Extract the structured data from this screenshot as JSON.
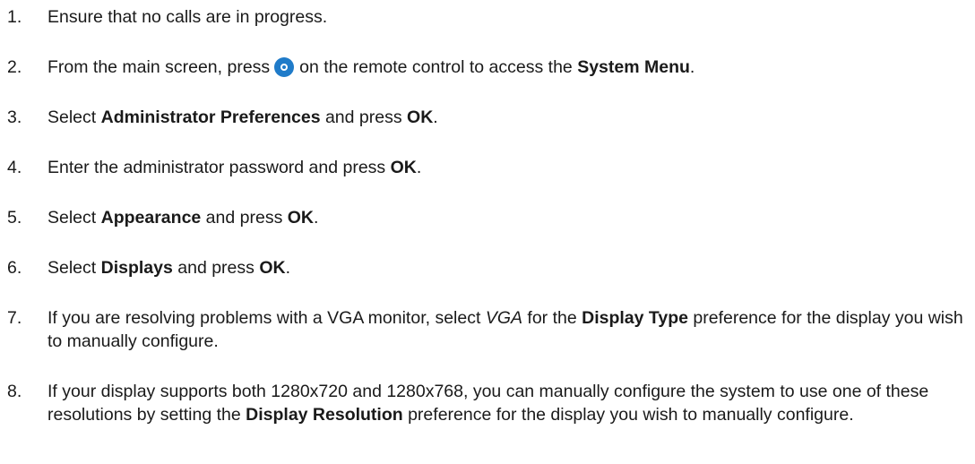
{
  "steps": [
    {
      "number": "1.",
      "parts": [
        {
          "text": "Ensure that no calls are in progress."
        }
      ]
    },
    {
      "number": "2.",
      "parts": [
        {
          "text": "From the main screen, press"
        },
        {
          "icon": "menu-button-icon"
        },
        {
          "text": "on the remote control to access the "
        },
        {
          "text": "System Menu",
          "bold": true
        },
        {
          "text": "."
        }
      ]
    },
    {
      "number": "3.",
      "parts": [
        {
          "text": "Select "
        },
        {
          "text": "Administrator Preferences",
          "bold": true
        },
        {
          "text": " and press "
        },
        {
          "text": "OK",
          "bold": true
        },
        {
          "text": "."
        }
      ]
    },
    {
      "number": "4.",
      "parts": [
        {
          "text": "Enter the administrator password and press "
        },
        {
          "text": "OK",
          "bold": true
        },
        {
          "text": "."
        }
      ]
    },
    {
      "number": "5.",
      "parts": [
        {
          "text": "Select "
        },
        {
          "text": "Appearance",
          "bold": true
        },
        {
          "text": " and press "
        },
        {
          "text": "OK",
          "bold": true
        },
        {
          "text": "."
        }
      ]
    },
    {
      "number": "6.",
      "parts": [
        {
          "text": "Select "
        },
        {
          "text": "Displays",
          "bold": true
        },
        {
          "text": " and press "
        },
        {
          "text": "OK",
          "bold": true
        },
        {
          "text": "."
        }
      ]
    },
    {
      "number": "7.",
      "parts": [
        {
          "text": "If you are resolving problems with a VGA monitor, select "
        },
        {
          "text": "VGA",
          "italic": true
        },
        {
          "text": " for the "
        },
        {
          "text": "Display Type",
          "bold": true
        },
        {
          "text": " preference for the display you wish to manually configure."
        }
      ]
    },
    {
      "number": "8.",
      "parts": [
        {
          "text": "If your display supports both 1280x720 and 1280x768, you can manually configure the system to use one of these resolutions by setting the "
        },
        {
          "text": "Display Resolution",
          "bold": true
        },
        {
          "text": " preference for the display you wish to manually configure."
        }
      ]
    }
  ],
  "colors": {
    "text": "#1a1a1a",
    "icon_blue": "#1f7bc9"
  }
}
